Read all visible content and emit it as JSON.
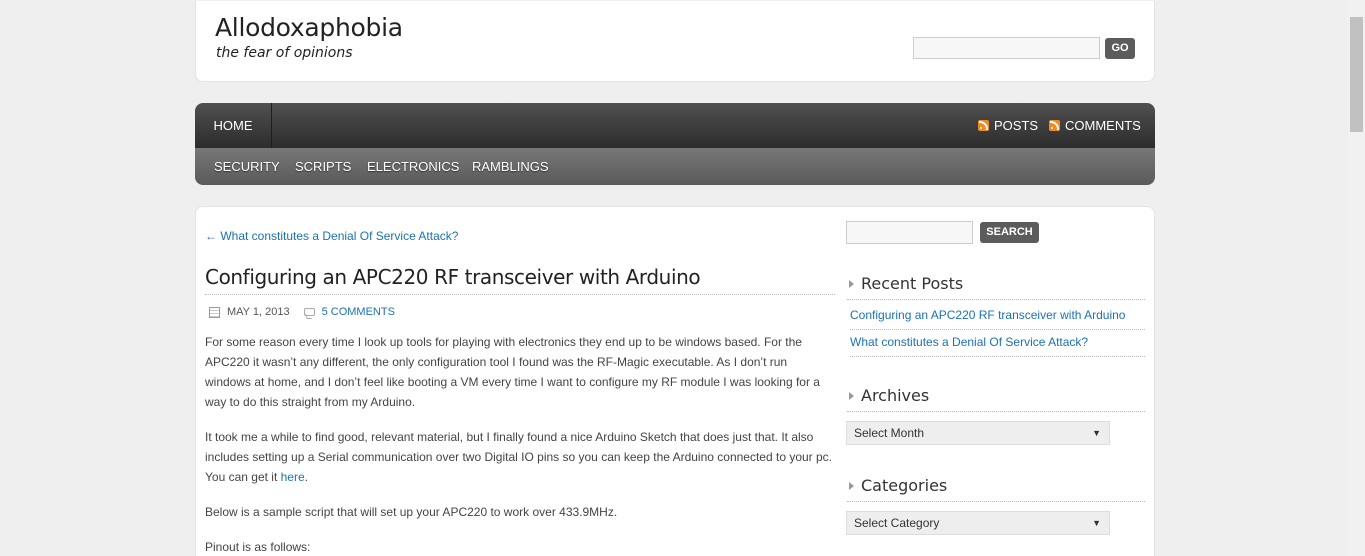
{
  "header": {
    "title": "Allodoxaphobia",
    "tagline": "the fear of opinions",
    "search_placeholder": "",
    "go_label": "GO"
  },
  "nav": {
    "home": "HOME",
    "posts": "POSTS",
    "comments": "COMMENTS",
    "categories": [
      "SECURITY",
      "SCRIPTS",
      "ELECTRONICS",
      "RAMBLINGS"
    ]
  },
  "post": {
    "prev_link": "← What constitutes a Denial Of Service Attack?",
    "title": "Configuring an APC220 RF transceiver with Arduino",
    "date": "MAY 1, 2013",
    "comments": "5 COMMENTS",
    "p1": "For some reason every time I look up tools for playing with electronics they end up to be windows based. For the APC220 it wasn’t any different, the only configuration tool I found was the RF-Magic executable. As I don’t run windows at home, and I don’t feel like booting a VM every time I want to configure my RF module I was looking for a way to do this straight from my Arduino.",
    "p2": "It took me a while to find good, relevant material, but I finally found a nice Arduino Sketch that does just that. It also includes setting up a Serial communication over two Digital IO pins so you can keep the Arduino connected to your pc. You can get it",
    "p2_link": "here",
    "p2_end": ".",
    "p3": "Below is a sample script that will set up your APC220 to work over 433.9MHz.",
    "p4": "Pinout is as follows:"
  },
  "sidebar": {
    "search_label": "SEARCH",
    "recent_title": "Recent Posts",
    "recent": [
      "Configuring an APC220 RF transceiver with Arduino",
      "What constitutes a Denial Of Service Attack?"
    ],
    "archives_title": "Archives",
    "archives_select": "Select Month",
    "categories_title": "Categories",
    "categories_select": "Select Category"
  },
  "colors": {
    "link": "#1a72b4",
    "nav_dark": "#2c2c2c",
    "rss": "#f08a22"
  }
}
